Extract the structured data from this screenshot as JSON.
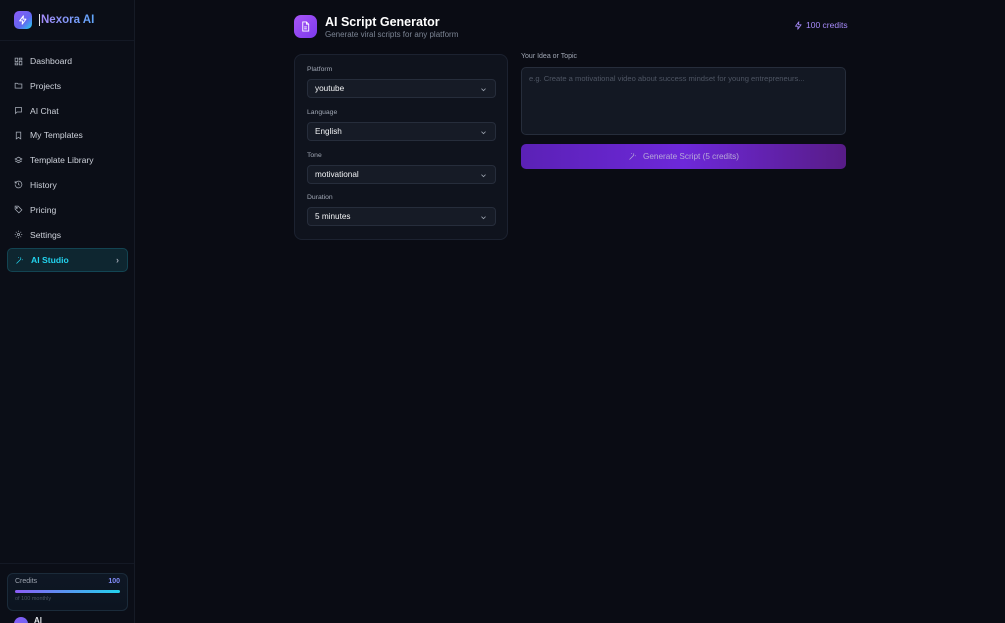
{
  "brand": {
    "name": "Nexora AI"
  },
  "sidebar": {
    "items": [
      {
        "label": "Dashboard",
        "icon": "grid-icon"
      },
      {
        "label": "Projects",
        "icon": "folder-icon"
      },
      {
        "label": "AI Chat",
        "icon": "chat-icon"
      },
      {
        "label": "My Templates",
        "icon": "bookmark-icon"
      },
      {
        "label": "Template Library",
        "icon": "layers-icon"
      },
      {
        "label": "History",
        "icon": "history-icon"
      },
      {
        "label": "Pricing",
        "icon": "tag-icon"
      },
      {
        "label": "Settings",
        "icon": "gear-icon"
      },
      {
        "label": "AI Studio",
        "icon": "wand-icon",
        "active": true
      }
    ],
    "credits": {
      "label": "Credits",
      "value": "100",
      "sub": "of 100 monthly",
      "fraction": 1.0
    },
    "user": {
      "name": "Al"
    }
  },
  "header": {
    "title": "AI Script Generator",
    "subtitle": "Generate viral scripts for any platform",
    "credits_badge": "100 credits"
  },
  "form": {
    "platform": {
      "label": "Platform",
      "value": "youtube"
    },
    "language": {
      "label": "Language",
      "value": "English"
    },
    "tone": {
      "label": "Tone",
      "value": "motivational"
    },
    "duration": {
      "label": "Duration",
      "value": "5 minutes"
    },
    "idea": {
      "label": "Your Idea or Topic",
      "placeholder": "e.g. Create a motivational video about success mindset for young entrepreneurs..."
    },
    "generate_label": "Generate Script (5 credits)"
  },
  "colors": {
    "accent": "#8b5cf6",
    "active": "#22d3ee",
    "background": "#0a0c14"
  }
}
